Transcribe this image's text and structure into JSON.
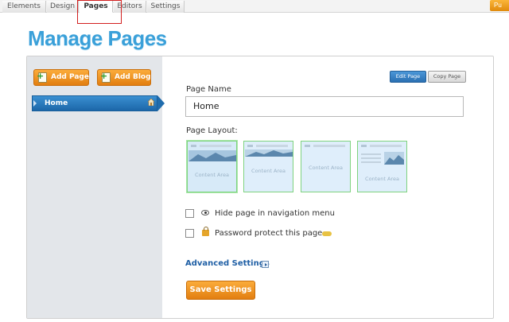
{
  "tabs": [
    {
      "label": "Elements",
      "active": false
    },
    {
      "label": "Design",
      "active": false
    },
    {
      "label": "Pages",
      "active": true
    },
    {
      "label": "Editors",
      "active": false
    },
    {
      "label": "Settings",
      "active": false
    }
  ],
  "publish_label": "Pu",
  "title": "Manage Pages",
  "sidebar": {
    "add_page_label": "Add Page",
    "add_blog_label": "Add Blog",
    "pages": [
      {
        "label": "Home",
        "selected": true
      }
    ]
  },
  "buttons": {
    "edit_page": "Edit Page",
    "copy_page": "Copy Page"
  },
  "form": {
    "page_name_label": "Page Name",
    "page_name_value": "Home",
    "page_layout_label": "Page Layout:",
    "layouts": [
      {
        "caption": "Content Area",
        "selected": true
      },
      {
        "caption": "Content Area",
        "selected": false
      },
      {
        "caption": "Content Area",
        "selected": false
      },
      {
        "caption": "Content Area",
        "selected": false
      }
    ],
    "hide_nav_label": "Hide page in navigation menu",
    "hide_nav_checked": false,
    "password_label": "Password protect this page",
    "password_checked": false,
    "advanced_label": "Advanced Settings",
    "save_label": "Save Settings"
  },
  "colors": {
    "accent_blue": "#3aa0d9",
    "orange": "#e8891a",
    "highlight_red": "#d21f1f"
  }
}
